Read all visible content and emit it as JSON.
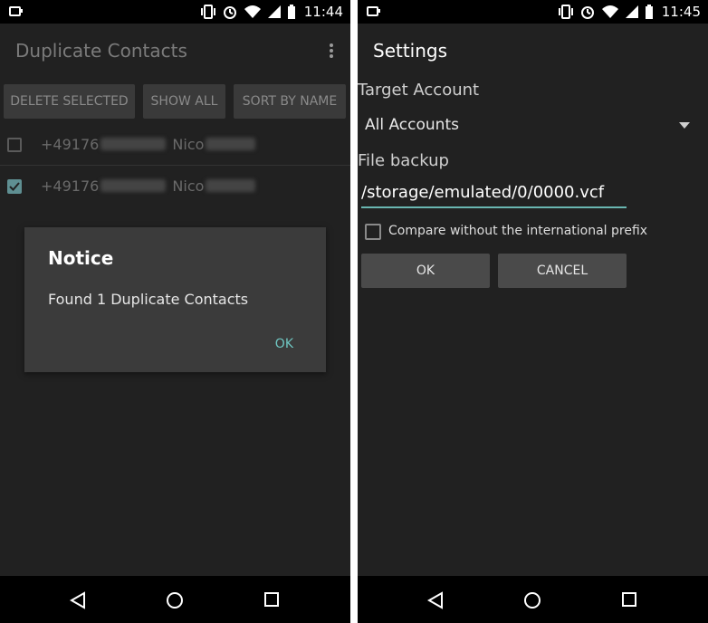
{
  "left": {
    "time": "11:44",
    "app_title": "Duplicate Contacts",
    "buttons": {
      "delete_selected": "DELETE SELECTED",
      "show_all": "SHOW ALL",
      "sort_by_name": "SORT BY NAME"
    },
    "contacts": [
      {
        "number_prefix": "+49176",
        "name_prefix": "Nico",
        "checked": false
      },
      {
        "number_prefix": "+49176",
        "name_prefix": "Nico",
        "checked": true
      }
    ],
    "dialog": {
      "title": "Notice",
      "message": "Found 1 Duplicate Contacts",
      "ok_label": "OK"
    }
  },
  "right": {
    "time": "11:45",
    "app_title": "Settings",
    "target_account_label": "Target Account",
    "target_account_value": "All Accounts",
    "file_backup_label": "File backup",
    "file_backup_value": "/storage/emulated/0/0000.vcf",
    "compare_label": "Compare without the international prefix",
    "ok_label": "OK",
    "cancel_label": "CANCEL"
  },
  "colors": {
    "accent": "#6fc6c1",
    "background": "#212121",
    "status_bar": "#000000"
  },
  "icons": {
    "status": [
      "notification-icon",
      "vibrate-icon",
      "alarm-icon",
      "wifi-icon",
      "signal-icon",
      "battery-icon"
    ],
    "nav": [
      "back-icon",
      "home-icon",
      "recents-icon"
    ]
  }
}
